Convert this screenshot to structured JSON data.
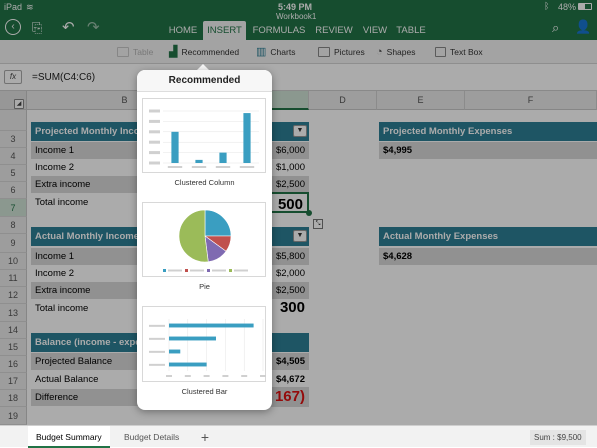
{
  "status": {
    "carrier": "iPad",
    "time": "5:49 PM",
    "battery": "48%",
    "doc_title": "Workbook1"
  },
  "ribbon_tabs": [
    {
      "label": "HOME"
    },
    {
      "label": "INSERT"
    },
    {
      "label": "FORMULAS"
    },
    {
      "label": "REVIEW"
    },
    {
      "label": "VIEW"
    },
    {
      "label": "TABLE"
    }
  ],
  "toolbar": {
    "table": "Table",
    "recommended": "Recommended",
    "charts": "Charts",
    "pictures": "Pictures",
    "shapes": "Shapes",
    "textbox": "Text Box"
  },
  "formula_bar": {
    "fx": "fx",
    "formula": "=SUM(C4:C6)"
  },
  "columns": [
    "B",
    "D",
    "E",
    "F"
  ],
  "rows": [
    "3",
    "4",
    "5",
    "6",
    "7",
    "8",
    "9",
    "10",
    "11",
    "12",
    "13",
    "14",
    "15",
    "16",
    "17",
    "18",
    "19"
  ],
  "sheet": {
    "proj_income_title": "Projected Monthly Income",
    "proj_income_rows": [
      {
        "label": "Income 1",
        "value": "$6,000"
      },
      {
        "label": "Income 2",
        "value": "$1,000"
      },
      {
        "label": "Extra income",
        "value": "$2,500"
      },
      {
        "label": "Total income",
        "value": "500"
      }
    ],
    "act_income_title": "Actual Monthly Income",
    "act_income_rows": [
      {
        "label": "Income 1",
        "value": "$5,800"
      },
      {
        "label": "Income 2",
        "value": "$2,000"
      },
      {
        "label": "Extra income",
        "value": "$2,500"
      },
      {
        "label": "Total income",
        "value": "300"
      }
    ],
    "balance_title": "Balance (income - expenses)",
    "balance_rows": [
      {
        "label": "Projected Balance",
        "value": "$4,505"
      },
      {
        "label": "Actual Balance",
        "value": "$4,672"
      },
      {
        "label": "Difference",
        "value": "167)"
      }
    ],
    "proj_exp_title": "Projected Monthly Expenses",
    "proj_exp_value": "$4,995",
    "act_exp_title": "Actual Monthly Expenses",
    "act_exp_value": "$4,628"
  },
  "popover": {
    "title": "Recommended",
    "options": [
      {
        "label": "Clustered Column"
      },
      {
        "label": "Pie"
      },
      {
        "label": "Clustered Bar"
      }
    ]
  },
  "sheets": [
    {
      "label": "Budget Summary"
    },
    {
      "label": "Budget Details"
    }
  ],
  "sum_readout": "Sum : $9,500",
  "colors": {
    "excel_green": "#217346",
    "band_blue": "#2e7f95",
    "chart_blue": "#3a9ec1",
    "negative_red": "#d11"
  },
  "pie_chart": {
    "slices": [
      {
        "value": 0.25,
        "color": "#3a9ec1"
      },
      {
        "value": 0.1,
        "color": "#c0504d"
      },
      {
        "value": 0.13,
        "color": "#7f6ab1"
      },
      {
        "value": 0.52,
        "color": "#9bbb59"
      }
    ]
  },
  "column_chart": {
    "values": [
      60,
      6,
      20,
      96
    ]
  },
  "bar_chart": {
    "values": [
      90,
      50,
      12,
      40
    ]
  }
}
